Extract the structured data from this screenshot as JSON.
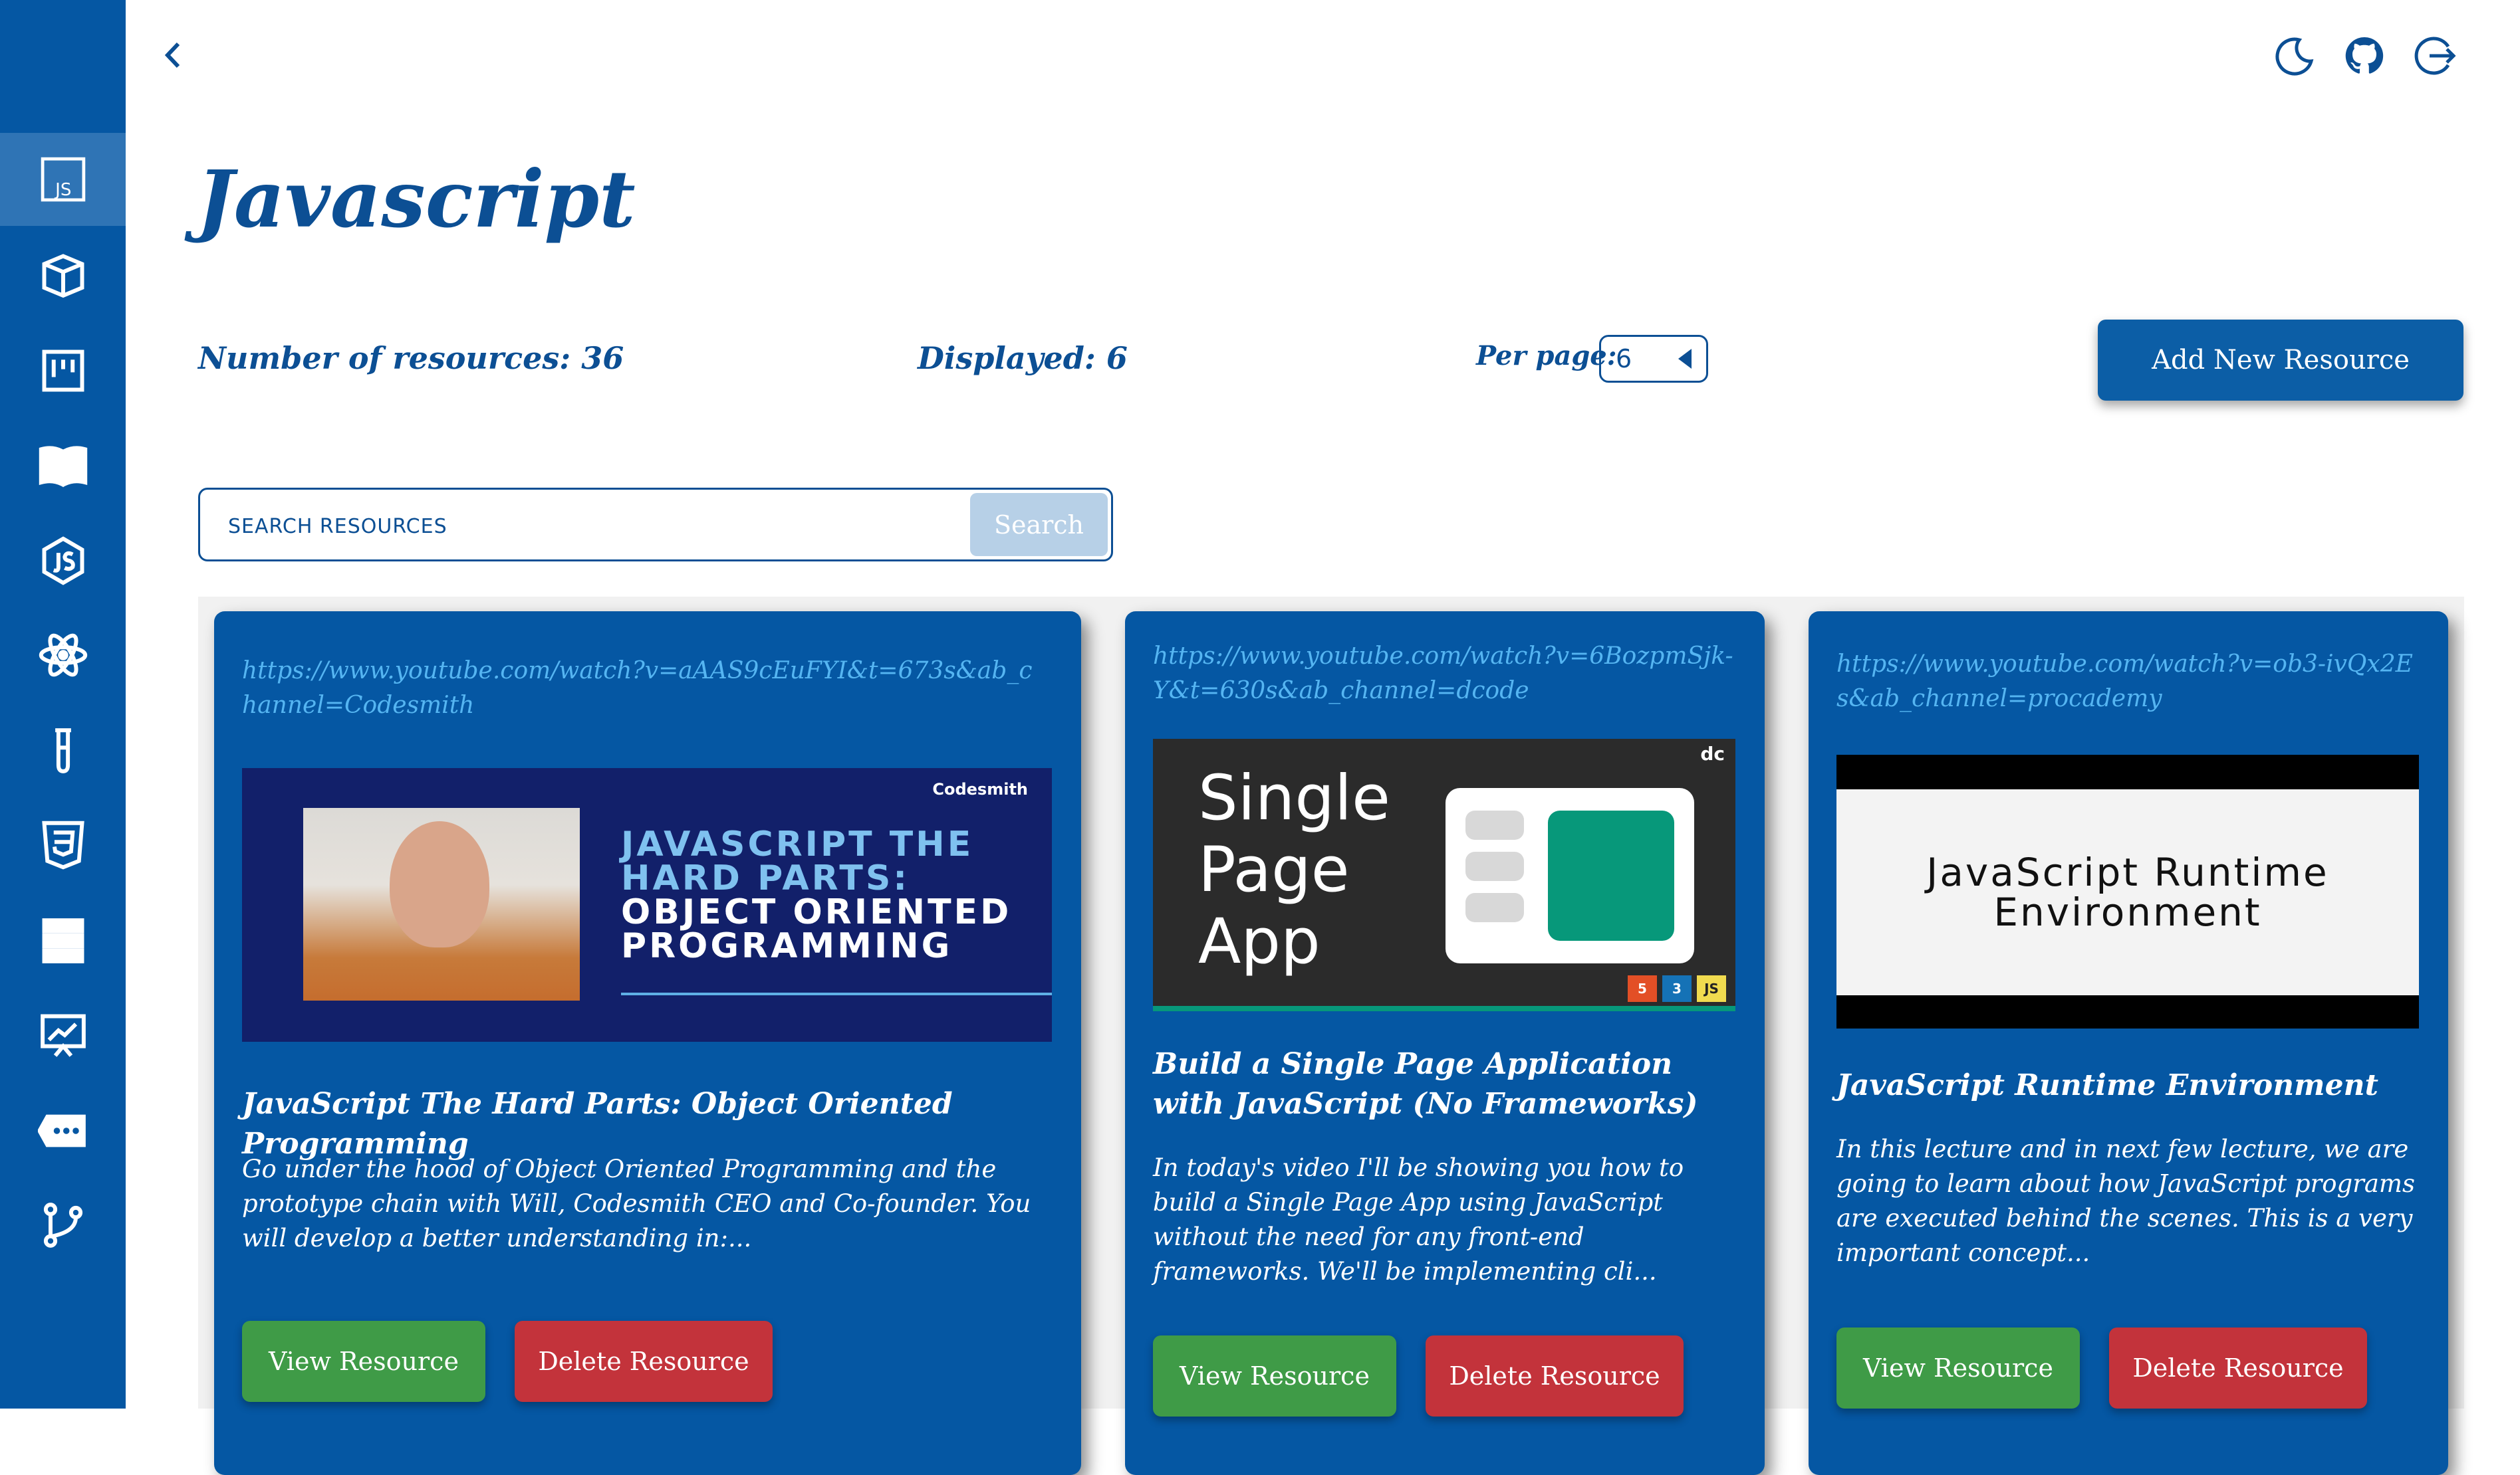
{
  "header": {
    "title": "Javascript",
    "icons": [
      "back-icon",
      "moon-icon",
      "github-icon",
      "logout-icon"
    ]
  },
  "sidebar": {
    "items": [
      {
        "name": "javascript",
        "icon": "js-icon",
        "label": "JS",
        "active": true
      },
      {
        "name": "package",
        "icon": "cube-icon"
      },
      {
        "name": "board",
        "icon": "kanban-icon"
      },
      {
        "name": "docs",
        "icon": "book-icon"
      },
      {
        "name": "node",
        "icon": "nodejs-icon"
      },
      {
        "name": "react",
        "icon": "react-icon"
      },
      {
        "name": "testing",
        "icon": "test-tube-icon"
      },
      {
        "name": "css",
        "icon": "css3-icon"
      },
      {
        "name": "database",
        "icon": "server-icon"
      },
      {
        "name": "presentation",
        "icon": "chart-board-icon"
      },
      {
        "name": "more",
        "icon": "more-icon"
      },
      {
        "name": "git",
        "icon": "git-branch-icon"
      }
    ]
  },
  "stats": {
    "total": "Number of resources: 36",
    "displayed": "Displayed: 6",
    "per_page_label": "Per page:",
    "per_page_value": "6"
  },
  "actions": {
    "add_label": "Add New Resource"
  },
  "search": {
    "placeholder": "SEARCH RESOURCES",
    "button_label": "Search"
  },
  "cards": [
    {
      "url": "https://www.youtube.com/watch?v=aAAS9cEuFYI&t=673s&ab_channel=Codesmith",
      "title": "JavaScript The Hard Parts: Object Oriented Programming",
      "description": "Go under the hood of Object Oriented Programming and the prototype chain with Will, Codesmith CEO and Co-founder. You will develop a better understanding in:...",
      "thumb_text_line1": "JAVASCRIPT THE",
      "thumb_text_line2": "HARD PARTS:",
      "thumb_text_line3": "OBJECT ORIENTED",
      "thumb_text_line4": "PROGRAMMING",
      "thumb_logo": "Codesmith",
      "view_label": "View Resource",
      "delete_label": "Delete Resource"
    },
    {
      "url": "https://www.youtube.com/watch?v=6BozpmSjk-Y&t=630s&ab_channel=dcode",
      "title": "Build a Single Page Application with JavaScript (No Frameworks)",
      "description": "In today's video I'll be showing you how to build a Single Page App using JavaScript without the need for any front-end frameworks. We'll be implementing cli...",
      "thumb_line1": "Single",
      "thumb_line2": "Page",
      "thumb_line3": "App",
      "thumb_logo": "dc",
      "badges": [
        "5",
        "3",
        "JS"
      ],
      "view_label": "View Resource",
      "delete_label": "Delete Resource"
    },
    {
      "url": "https://www.youtube.com/watch?v=ob3-ivQx2Es&ab_channel=procademy",
      "title": "JavaScript Runtime Environment",
      "description": "In this lecture and in next few lecture, we are going to learn about how JavaScript programs are executed behind the scenes. This is a very important concept...",
      "thumb_line1": "JavaScript Runtime",
      "thumb_line2": "Environment",
      "view_label": "View Resource",
      "delete_label": "Delete Resource"
    }
  ],
  "colors": {
    "sidebar": "#0557a3",
    "primary_text": "#0c4f94",
    "card_bg": "#0557a3",
    "link": "#55b5f2",
    "view_button": "#3f9b47",
    "delete_button": "#c3333b"
  }
}
